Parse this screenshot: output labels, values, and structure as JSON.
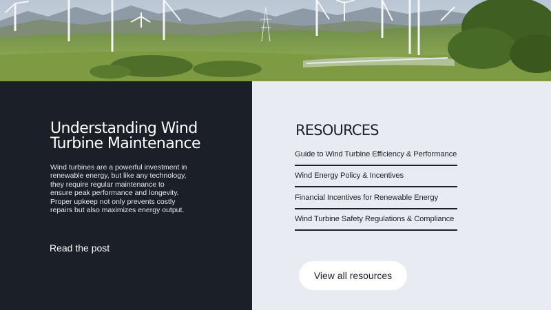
{
  "hero": {
    "alt": "Wind turbines on green rolling hills"
  },
  "post": {
    "title_line1": "Understanding Wind",
    "title_line2": "Turbine Maintenance",
    "body": "Wind turbines are a powerful investment in renewable energy, but like any technology, they require regular maintenance to ensure peak performance and longevity. Proper upkeep not only prevents costly repairs but also maximizes energy output.",
    "read_link": "Read the post"
  },
  "resources": {
    "title": "RESOURCES",
    "items": [
      {
        "label": "Guide to Wind Turbine Efficiency & Performance"
      },
      {
        "label": "Wind Energy Policy & Incentives"
      },
      {
        "label": "Financial Incentives for Renewable Energy"
      },
      {
        "label": "Wind Turbine Safety Regulations & Compliance"
      }
    ],
    "view_all_label": "View all resources"
  },
  "colors": {
    "dark_panel": "#1b1f27",
    "light_panel": "#e9ebf2",
    "button_bg": "#ffffff"
  }
}
